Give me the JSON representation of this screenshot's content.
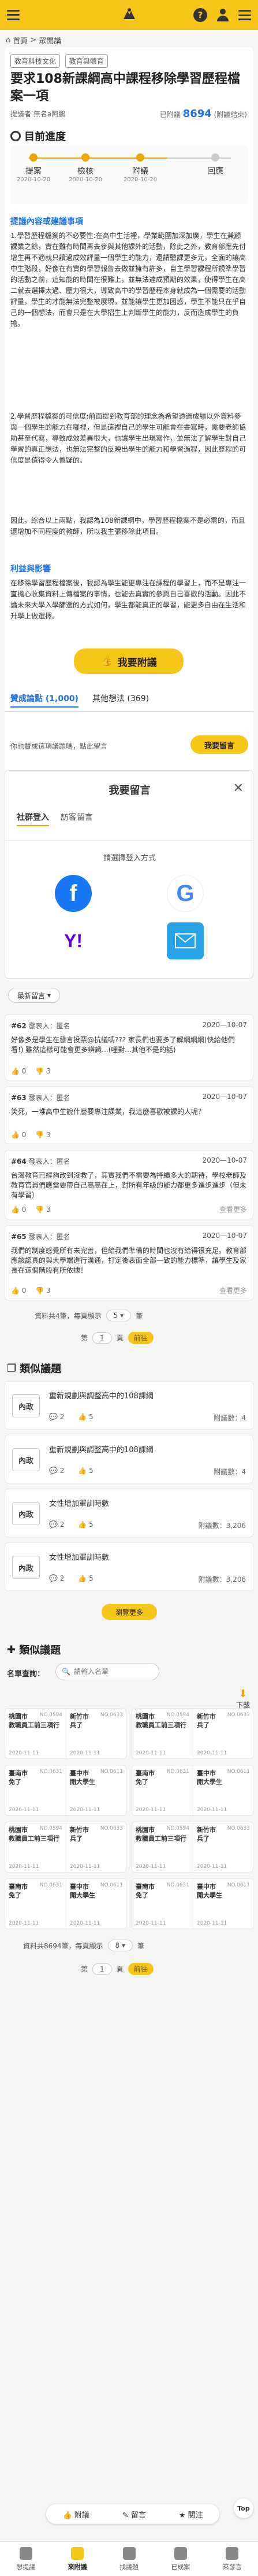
{
  "breadcrumb": {
    "home": "首頁",
    "current": "眾開講"
  },
  "tags": [
    "教育科技文化",
    "教育與體育"
  ],
  "title": "要求108新課綱高中課程移除學習歷程檔案一項",
  "meta": {
    "proposer": "提議者 無名a阿鵬",
    "agree_prefix": "已附議",
    "agree_count": "8694",
    "agree_suffix": "(附議結束)"
  },
  "progress": {
    "title": "目前進度",
    "steps": [
      {
        "label": "提案",
        "date": "2020-10-20"
      },
      {
        "label": "檢核",
        "date": "2020-10-20"
      },
      {
        "label": "附議",
        "date": "2020-10-20"
      },
      {
        "label": "回應",
        "date": ""
      }
    ]
  },
  "content": {
    "heading": "提議內容或建議事項",
    "p1": "1.學習歷程檔案的不必要性:在高中生活裡，學業範圍加深加廣，學生在兼顧課業之餘，實在難有時間再去參與其他課外的活動，除此之外，教育部應先付增生再不適就只讀過成效評量一個學生的能力，還請聽課更多元，全面的讓高中生階段，好像在有實的學習報告去做並擁有許多，自主學習課程所規準學習的活動之前，這知能的時間在很難上，並無法達成預期的效果，使得學生在高二就去選擇太過、壓力很大，導致高中的學習歷程本身就成為一個需要的活動評量，學生的才能無法完整被展現，並能讓學生更加困惑，學生不能只在乎自己的一個想法，而會只是在大學招生上判斷學生的能力，反而造成學生的負擔。",
    "p2": "2.學習歷程檔案的可信度:前面提到教育部的理念為希望透過成績以外資料參與一個學生的能力在哪裡，但是這裡自己的學生可能會在書寫時，需要老師協助甚至代寫，導致成效差異很大，也讓學生出現寫作，並無法了解學生對自己學習的真正想法，也無法完整的反映出學生的能力和學習過程，因此歷程的可信度是值得令人懷疑的。",
    "p3": "因此，綜合以上兩點，我認為108新課綱中，學習歷程檔案不是必需的，而且還增加不同程度的教師，所以我主張移除此項目。",
    "benefit_heading": "利益與影響",
    "benefit": "在移除學習歷程檔案後，我認為學生能更專注在課程的學習上，而不是專注一直擔心收集資料上傳檔案的事情，也能去真實的參與自己喜歡的活動。因此不論未來大學入學篩選的方式如何，學生都能真正的學習，能更多自由在生活和升學上做選擇。"
  },
  "attach_button": "我要附議",
  "discussion": {
    "tab_agree": "贊成論點 (1,000)",
    "tab_other": "其他想法 (369)",
    "prompt": "你也贊成這項議題嗎，點此留言",
    "comment_button": "我要留言"
  },
  "login": {
    "title": "我要留言",
    "tab_social": "社群登入",
    "tab_guest": "訪客留言",
    "subtitle": "請選擇登入方式"
  },
  "sort_label": "最新留言",
  "comments": [
    {
      "num": "#62",
      "author": "發表人：匿名",
      "date": "2020—10-07",
      "body": "好像多是學生在發言投票@抗議嗎??? 家長們也要多了解網網網(快給他們看!) 雖然這樣可能會更多辨識...(哩對...其他不是的話)",
      "up": "0",
      "down": "3",
      "reply": ""
    },
    {
      "num": "#63",
      "author": "發表人：匿名",
      "date": "2020—10-07",
      "body": "笑死，一堆高中生說什麼要專注課業，我這麼喜歡被課的人呢？",
      "up": "0",
      "down": "3",
      "reply": ""
    },
    {
      "num": "#64",
      "author": "發表人：匿名",
      "date": "2020—10-07",
      "body": "台灣教育已經夠改到沒救了，其實我們不需要為持續多大的期待，學校老師及教育官員們應當要帶自己高高在上，對所有年級的能力都更多進步進步（但未有學習）",
      "up": "0",
      "down": "3",
      "reply": "查看更多"
    },
    {
      "num": "#65",
      "author": "發表人：匿名",
      "date": "2020—10-07",
      "body": "我們的制度感覺所有未完善，但給我們準備的時間也沒有給得很充足。教育部應該認真的與大學端進行溝通，打定後表面全部一致的能力標準，讓學生及家長在這個階段有所依據！",
      "up": "0",
      "down": "3",
      "reply": "查看更多"
    }
  ],
  "comment_pager": {
    "total": "資料共4筆，每頁顯示",
    "per_page": "5",
    "unit": "筆",
    "page_prefix": "第",
    "page": "1",
    "page_suffix": "頁",
    "go": "前往"
  },
  "related": {
    "heading": "類似議題",
    "items": [
      {
        "tag": "內政",
        "title": "重新規劃與調整高中的108課綱",
        "comments": "2",
        "likes": "5",
        "count": "附議數：4"
      },
      {
        "tag": "內政",
        "title": "重新規劃與調整高中的108課綱",
        "comments": "2",
        "likes": "5",
        "count": "附議數：4"
      },
      {
        "tag": "內政",
        "title": "女性增加軍訓時數",
        "comments": "2",
        "likes": "5",
        "count": "附議數：3,206"
      },
      {
        "tag": "內政",
        "title": "女性增加軍訓時數",
        "comments": "2",
        "likes": "5",
        "count": "附議數：3,206"
      }
    ],
    "more": "瀏覽更多"
  },
  "similar": {
    "heading": "類似議題",
    "search_label": "名單查詢：",
    "search_placeholder": "請輸入名單",
    "download": "下載",
    "cards": [
      {
        "a_title": "桃園市",
        "a_sub": "教職員工前三項行",
        "a_num": "NO.0594",
        "a_date": "2020-11-11",
        "b_title": "新竹市",
        "b_sub": "兵了",
        "b_num": "NO.0633",
        "b_date": "2020-11-11"
      },
      {
        "a_title": "桃園市",
        "a_sub": "教職員工前三項行",
        "a_num": "NO.0594",
        "a_date": "2020-11-11",
        "b_title": "新竹市",
        "b_sub": "兵了",
        "b_num": "NO.0633",
        "b_date": "2020-11-11"
      },
      {
        "a_title": "臺南市",
        "a_sub": "免了",
        "a_num": "NO.0631",
        "a_date": "2020-11-11",
        "b_title": "臺中市",
        "b_sub": "開大學生",
        "b_num": "NO.0611",
        "b_date": "2020-11-11"
      },
      {
        "a_title": "臺南市",
        "a_sub": "免了",
        "a_num": "NO.0631",
        "a_date": "2020-11-11",
        "b_title": "臺中市",
        "b_sub": "開大學生",
        "b_num": "NO.0611",
        "b_date": "2020-11-11"
      },
      {
        "a_title": "桃園市",
        "a_sub": "教職員工前三項行",
        "a_num": "NO.0594",
        "a_date": "2020-11-11",
        "b_title": "新竹市",
        "b_sub": "兵了",
        "b_num": "NO.0633",
        "b_date": "2020-11-11"
      },
      {
        "a_title": "桃園市",
        "a_sub": "教職員工前三項行",
        "a_num": "NO.0594",
        "a_date": "2020-11-11",
        "b_title": "新竹市",
        "b_sub": "兵了",
        "b_num": "NO.0633",
        "b_date": "2020-11-11"
      },
      {
        "a_title": "臺南市",
        "a_sub": "免了",
        "a_num": "NO.0631",
        "a_date": "2020-11-11",
        "b_title": "臺中市",
        "b_sub": "開大學生",
        "b_num": "NO.0611",
        "b_date": "2020-11-11"
      },
      {
        "a_title": "臺南市",
        "a_sub": "免了",
        "a_num": "NO.0631",
        "a_date": "2020-11-11",
        "b_title": "臺中市",
        "b_sub": "開大學生",
        "b_num": "NO.0611",
        "b_date": "2020-11-11"
      }
    ],
    "pager": {
      "total": "資料共8694筆，每頁顯示",
      "per_page": "8",
      "unit": "筆",
      "page_prefix": "第",
      "page": "1",
      "page_suffix": "頁",
      "go": "前往"
    }
  },
  "floatbar": {
    "attach": "附議",
    "comment": "留言",
    "follow": "關注"
  },
  "totop": "Top",
  "bottomnav": [
    "想提議",
    "來附議",
    "找議題",
    "已成案",
    "來發言"
  ],
  "colors": {
    "brand": "#f5c518",
    "link": "#1a73e8"
  }
}
